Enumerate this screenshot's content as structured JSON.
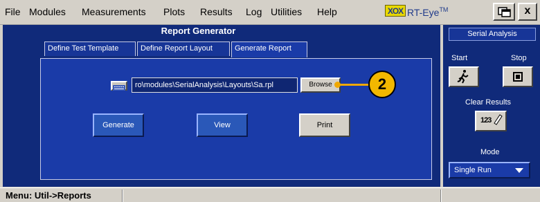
{
  "menu": {
    "items": [
      "File",
      "Modules",
      "Measurements",
      "Plots",
      "Results",
      "Log",
      "Utilities",
      "Help"
    ],
    "brand_logo": "XOX",
    "brand_name": "RT-Eye",
    "brand_tm": "TM",
    "close_label": "x"
  },
  "main": {
    "title": "Report Generator",
    "tabs": [
      "Define Test Template",
      "Define Report Layout",
      "Generate Report"
    ],
    "active_tab": 2,
    "path_value": "ro\\modules\\SerialAnalysis\\Layouts\\Sa.rpl",
    "browse_label": "Browse",
    "generate_label": "Generate",
    "view_label": "View",
    "print_label": "Print"
  },
  "callout": {
    "number": "2",
    "color": "#f2b700"
  },
  "side": {
    "title": "Serial Analysis",
    "start_label": "Start",
    "stop_label": "Stop",
    "clear_label": "Clear Results",
    "clear_icon_text": "123",
    "mode_label": "Mode",
    "mode_value": "Single Run"
  },
  "status": {
    "text": "Menu: Util->Reports"
  },
  "colors": {
    "panel": "#102a7a",
    "tab": "#173597",
    "chrome": "#d4d0c8"
  }
}
